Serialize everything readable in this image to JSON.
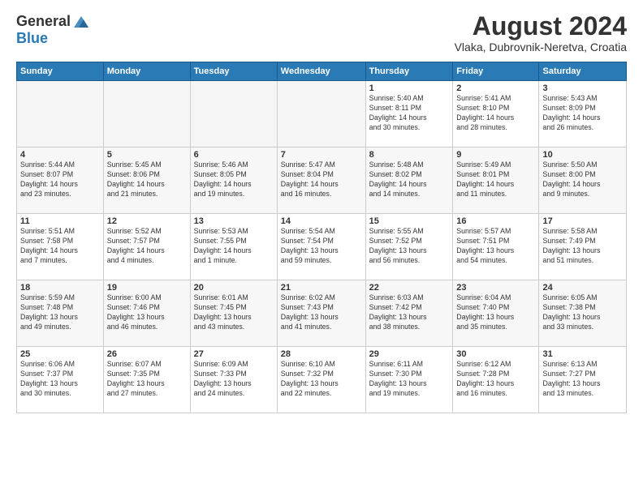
{
  "logo": {
    "general": "General",
    "blue": "Blue"
  },
  "title": "August 2024",
  "location": "Vlaka, Dubrovnik-Neretva, Croatia",
  "weekdays": [
    "Sunday",
    "Monday",
    "Tuesday",
    "Wednesday",
    "Thursday",
    "Friday",
    "Saturday"
  ],
  "weeks": [
    [
      {
        "day": "",
        "info": ""
      },
      {
        "day": "",
        "info": ""
      },
      {
        "day": "",
        "info": ""
      },
      {
        "day": "",
        "info": ""
      },
      {
        "day": "1",
        "info": "Sunrise: 5:40 AM\nSunset: 8:11 PM\nDaylight: 14 hours\nand 30 minutes."
      },
      {
        "day": "2",
        "info": "Sunrise: 5:41 AM\nSunset: 8:10 PM\nDaylight: 14 hours\nand 28 minutes."
      },
      {
        "day": "3",
        "info": "Sunrise: 5:43 AM\nSunset: 8:09 PM\nDaylight: 14 hours\nand 26 minutes."
      }
    ],
    [
      {
        "day": "4",
        "info": "Sunrise: 5:44 AM\nSunset: 8:07 PM\nDaylight: 14 hours\nand 23 minutes."
      },
      {
        "day": "5",
        "info": "Sunrise: 5:45 AM\nSunset: 8:06 PM\nDaylight: 14 hours\nand 21 minutes."
      },
      {
        "day": "6",
        "info": "Sunrise: 5:46 AM\nSunset: 8:05 PM\nDaylight: 14 hours\nand 19 minutes."
      },
      {
        "day": "7",
        "info": "Sunrise: 5:47 AM\nSunset: 8:04 PM\nDaylight: 14 hours\nand 16 minutes."
      },
      {
        "day": "8",
        "info": "Sunrise: 5:48 AM\nSunset: 8:02 PM\nDaylight: 14 hours\nand 14 minutes."
      },
      {
        "day": "9",
        "info": "Sunrise: 5:49 AM\nSunset: 8:01 PM\nDaylight: 14 hours\nand 11 minutes."
      },
      {
        "day": "10",
        "info": "Sunrise: 5:50 AM\nSunset: 8:00 PM\nDaylight: 14 hours\nand 9 minutes."
      }
    ],
    [
      {
        "day": "11",
        "info": "Sunrise: 5:51 AM\nSunset: 7:58 PM\nDaylight: 14 hours\nand 7 minutes."
      },
      {
        "day": "12",
        "info": "Sunrise: 5:52 AM\nSunset: 7:57 PM\nDaylight: 14 hours\nand 4 minutes."
      },
      {
        "day": "13",
        "info": "Sunrise: 5:53 AM\nSunset: 7:55 PM\nDaylight: 14 hours\nand 1 minute."
      },
      {
        "day": "14",
        "info": "Sunrise: 5:54 AM\nSunset: 7:54 PM\nDaylight: 13 hours\nand 59 minutes."
      },
      {
        "day": "15",
        "info": "Sunrise: 5:55 AM\nSunset: 7:52 PM\nDaylight: 13 hours\nand 56 minutes."
      },
      {
        "day": "16",
        "info": "Sunrise: 5:57 AM\nSunset: 7:51 PM\nDaylight: 13 hours\nand 54 minutes."
      },
      {
        "day": "17",
        "info": "Sunrise: 5:58 AM\nSunset: 7:49 PM\nDaylight: 13 hours\nand 51 minutes."
      }
    ],
    [
      {
        "day": "18",
        "info": "Sunrise: 5:59 AM\nSunset: 7:48 PM\nDaylight: 13 hours\nand 49 minutes."
      },
      {
        "day": "19",
        "info": "Sunrise: 6:00 AM\nSunset: 7:46 PM\nDaylight: 13 hours\nand 46 minutes."
      },
      {
        "day": "20",
        "info": "Sunrise: 6:01 AM\nSunset: 7:45 PM\nDaylight: 13 hours\nand 43 minutes."
      },
      {
        "day": "21",
        "info": "Sunrise: 6:02 AM\nSunset: 7:43 PM\nDaylight: 13 hours\nand 41 minutes."
      },
      {
        "day": "22",
        "info": "Sunrise: 6:03 AM\nSunset: 7:42 PM\nDaylight: 13 hours\nand 38 minutes."
      },
      {
        "day": "23",
        "info": "Sunrise: 6:04 AM\nSunset: 7:40 PM\nDaylight: 13 hours\nand 35 minutes."
      },
      {
        "day": "24",
        "info": "Sunrise: 6:05 AM\nSunset: 7:38 PM\nDaylight: 13 hours\nand 33 minutes."
      }
    ],
    [
      {
        "day": "25",
        "info": "Sunrise: 6:06 AM\nSunset: 7:37 PM\nDaylight: 13 hours\nand 30 minutes."
      },
      {
        "day": "26",
        "info": "Sunrise: 6:07 AM\nSunset: 7:35 PM\nDaylight: 13 hours\nand 27 minutes."
      },
      {
        "day": "27",
        "info": "Sunrise: 6:09 AM\nSunset: 7:33 PM\nDaylight: 13 hours\nand 24 minutes."
      },
      {
        "day": "28",
        "info": "Sunrise: 6:10 AM\nSunset: 7:32 PM\nDaylight: 13 hours\nand 22 minutes."
      },
      {
        "day": "29",
        "info": "Sunrise: 6:11 AM\nSunset: 7:30 PM\nDaylight: 13 hours\nand 19 minutes."
      },
      {
        "day": "30",
        "info": "Sunrise: 6:12 AM\nSunset: 7:28 PM\nDaylight: 13 hours\nand 16 minutes."
      },
      {
        "day": "31",
        "info": "Sunrise: 6:13 AM\nSunset: 7:27 PM\nDaylight: 13 hours\nand 13 minutes."
      }
    ]
  ]
}
